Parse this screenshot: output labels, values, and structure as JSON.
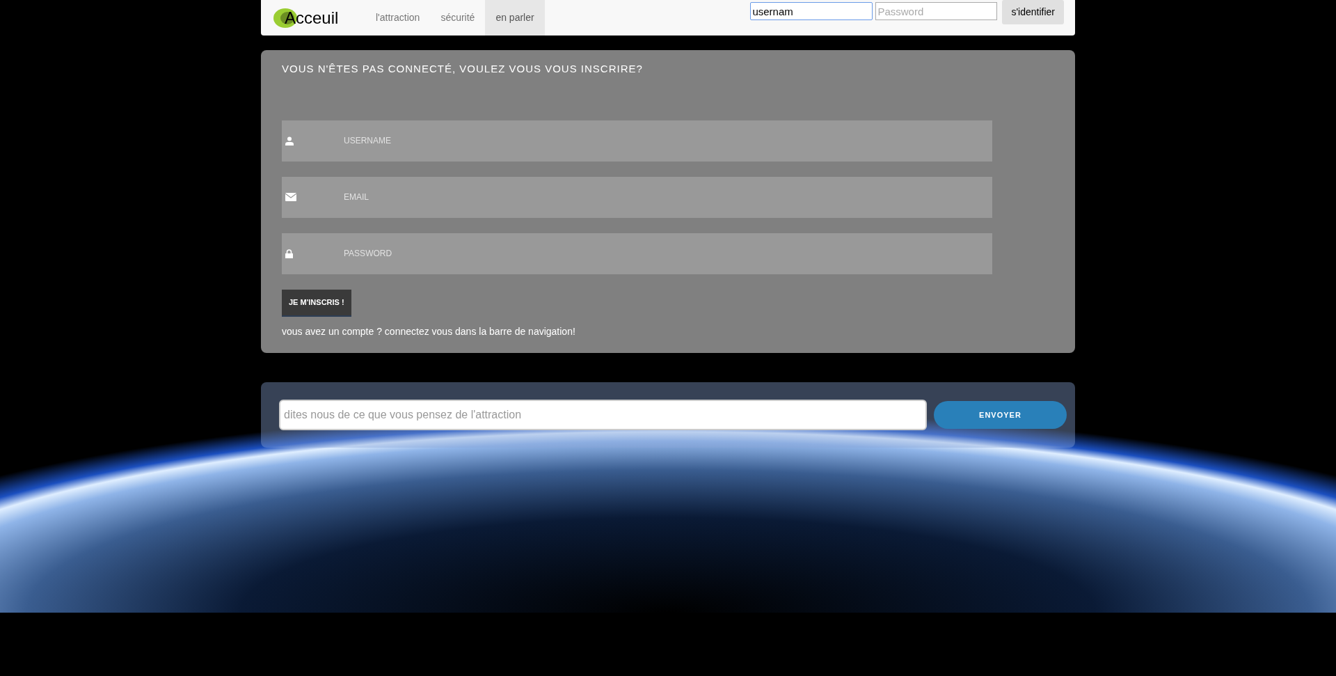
{
  "navbar": {
    "brand": "Acceuil",
    "links": [
      {
        "label": "l'attraction",
        "selected": false
      },
      {
        "label": "sécurité",
        "selected": false
      },
      {
        "label": "en parler",
        "selected": true
      }
    ],
    "login": {
      "username": {
        "value": "usernam"
      },
      "password": {
        "placeholder": "Password"
      },
      "button": "s'identifier"
    }
  },
  "register": {
    "title": "VOUS N'ÊTES PAS CONNECTÉ, VOULEZ VOUS VOUS INSCRIRE?",
    "fields": [
      {
        "kind": "user",
        "placeholder": "USERNAME"
      },
      {
        "kind": "email",
        "placeholder": "EMAIL"
      },
      {
        "kind": "password",
        "placeholder": "PASSWORD"
      }
    ],
    "button": "JE M'INSCRIS !",
    "note": "vous avez un compte ? connectez vous dans la barre de navigation!"
  },
  "feedback": {
    "placeholder": "dites nous de ce que vous pensez de l'attraction",
    "button": "ENVOYER"
  }
}
